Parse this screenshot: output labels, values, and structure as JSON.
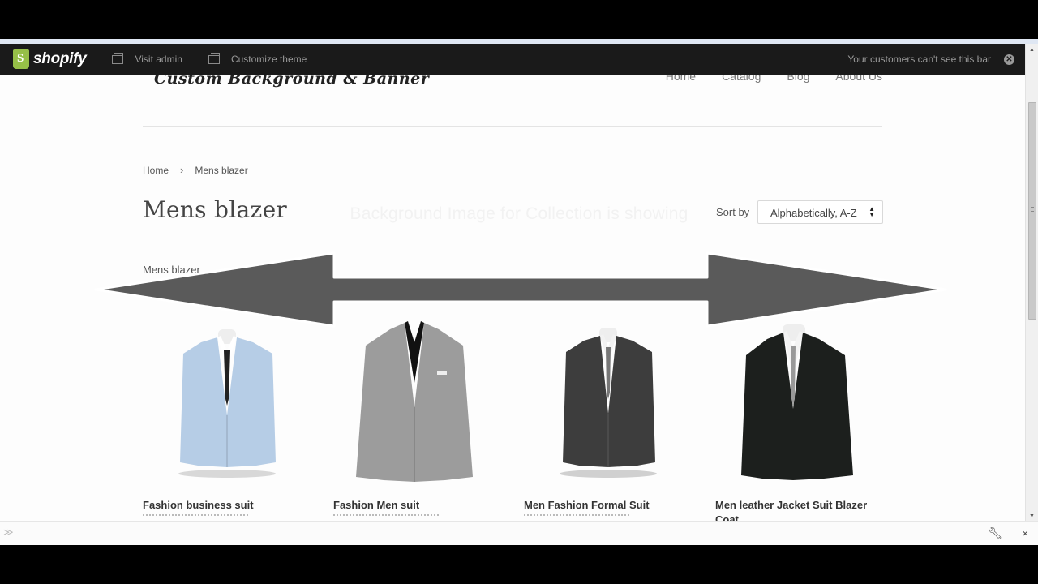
{
  "admin_bar": {
    "logo_text": "shopify",
    "visit_admin": "Visit admin",
    "customize_theme": "Customize theme",
    "note": "Your customers can't see this bar",
    "close_glyph": "✕"
  },
  "site": {
    "title": "Custom Background & Banner",
    "nav": [
      "Home",
      "Catalog",
      "Blog",
      "About Us"
    ]
  },
  "breadcrumb": {
    "home": "Home",
    "separator": "›",
    "current": "Mens blazer"
  },
  "collection": {
    "title": "Mens blazer",
    "description": "Mens blazer",
    "sort_label": "Sort by",
    "sort_value": "Alphabetically, A-Z"
  },
  "overlay": {
    "text": "Background Image for Collection is showing",
    "arrow_color": "#5a5a5a"
  },
  "products": [
    {
      "name": "Fashion business suit",
      "jacket_color": "#b6cde6"
    },
    {
      "name": "Fashion Men suit",
      "jacket_color": "#9c9c9c"
    },
    {
      "name": "Men Fashion Formal Suit",
      "jacket_color": "#3d3d3d"
    },
    {
      "name": "Men leather Jacket Suit Blazer Coat",
      "jacket_color": "#1c1f1d"
    }
  ],
  "bottom_bar": {
    "left_glyph": "≫",
    "right_close": "×"
  },
  "icons": {
    "wrench": "wrench-icon",
    "window": "window-icon"
  }
}
